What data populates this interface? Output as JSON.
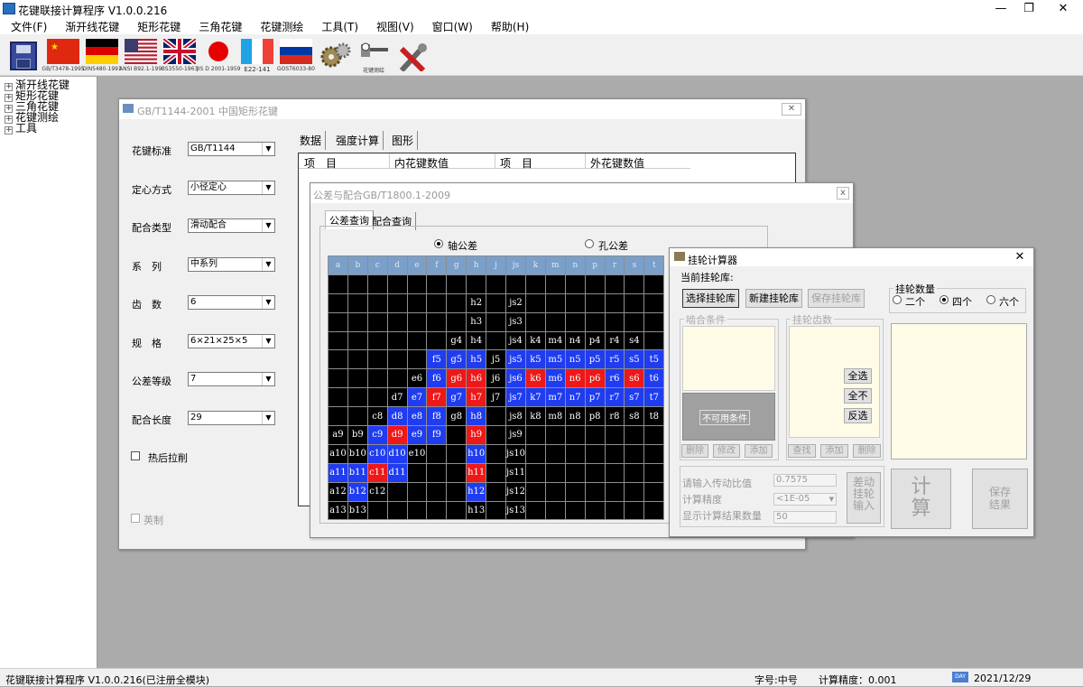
{
  "app": {
    "title": "花键联接计算程序 V1.0.0.216"
  },
  "menu": [
    "文件(F)",
    "渐开线花键",
    "矩形花键",
    "三角花键",
    "花键测绘",
    "工具(T)",
    "视图(V)",
    "窗口(W)",
    "帮助(H)"
  ],
  "toolbar": [
    {
      "icon": "save-icon",
      "caption": ""
    },
    {
      "icon": "china-flag-icon",
      "caption": "GB/T3478-1995"
    },
    {
      "icon": "germany-flag-icon",
      "caption": "DIN5480-1991"
    },
    {
      "icon": "usa-flag-icon",
      "caption": "ANSI B92.1-1996"
    },
    {
      "icon": "uk-flag-icon",
      "caption": "BS3550-1963"
    },
    {
      "icon": "japan-flag-icon",
      "caption": "JIS D 2001-1959"
    },
    {
      "icon": "france-flag-icon",
      "caption": "E22-141"
    },
    {
      "icon": "russia-flag-icon",
      "caption": "GOST6033-80"
    },
    {
      "icon": "gears-icon",
      "caption": ""
    },
    {
      "icon": "measure-icon",
      "caption": "花键测绘"
    },
    {
      "icon": "tools-icon",
      "caption": ""
    }
  ],
  "tree": [
    "渐开线花键",
    "矩形花键",
    "三角花键",
    "花键测绘",
    "工具"
  ],
  "status": {
    "left": "花键联接计算程序  V1.0.0.216(已注册全模块)",
    "font": "字号:中号",
    "precision": "计算精度：0.001",
    "date": "2021/12/29",
    "day_icon": "DAY"
  },
  "rect_window": {
    "title": "GB/T1144-2001 中国矩形花键",
    "close": "✕",
    "fields": [
      {
        "label": "花键标准",
        "value": "GB/T1144"
      },
      {
        "label": "定心方式",
        "value": "小径定心"
      },
      {
        "label": "配合类型",
        "value": "滑动配合"
      },
      {
        "label": "系　列",
        "value": "中系列"
      },
      {
        "label": "齿　数",
        "value": "6"
      },
      {
        "label": "规　格",
        "value": "6×21×25×5"
      },
      {
        "label": "公差等级",
        "value": "7"
      },
      {
        "label": "配合长度",
        "value": "29"
      }
    ],
    "hot_broach": "热后拉削",
    "imperial": "英制",
    "tabs": [
      "数据",
      "强度计算",
      "图形"
    ],
    "table_headers": [
      "项　目",
      "内花键数值",
      "项　目",
      "外花键数值"
    ]
  },
  "tol_window": {
    "title": "公差与配合GB/T1800.1-2009",
    "close": "x",
    "tabs": [
      "公差查询",
      "配合查询"
    ],
    "radio_shaft": "轴公差",
    "radio_hole": "孔公差",
    "columns": [
      "a",
      "b",
      "c",
      "d",
      "e",
      "f",
      "g",
      "h",
      "j",
      "js",
      "k",
      "m",
      "n",
      "p",
      "r",
      "s",
      "t"
    ],
    "rows": [
      [
        "",
        "",
        "",
        "",
        "",
        "",
        "",
        "",
        "",
        "",
        "",
        "",
        "",
        "",
        "",
        "",
        ""
      ],
      [
        "",
        "",
        "",
        "",
        "",
        "",
        "",
        "h2",
        "",
        "js2",
        "",
        "",
        "",
        "",
        "",
        "",
        ""
      ],
      [
        "",
        "",
        "",
        "",
        "",
        "",
        "",
        "h3",
        "",
        "js3",
        "",
        "",
        "",
        "",
        "",
        "",
        ""
      ],
      [
        "",
        "",
        "",
        "",
        "",
        "",
        "g4",
        "h4",
        "",
        "js4",
        "k4",
        "m4",
        "n4",
        "p4",
        "r4",
        "s4",
        ""
      ],
      [
        "",
        "",
        "",
        "",
        "",
        "f5",
        "g5",
        "h5",
        "j5",
        "js5",
        "k5",
        "m5",
        "n5",
        "p5",
        "r5",
        "s5",
        "t5"
      ],
      [
        "",
        "",
        "",
        "",
        "e6",
        "f6",
        "g6",
        "h6",
        "j6",
        "js6",
        "k6",
        "m6",
        "n6",
        "p6",
        "r6",
        "s6",
        "t6"
      ],
      [
        "",
        "",
        "",
        "d7",
        "e7",
        "f7",
        "g7",
        "h7",
        "j7",
        "js7",
        "k7",
        "m7",
        "n7",
        "p7",
        "r7",
        "s7",
        "t7"
      ],
      [
        "",
        "",
        "c8",
        "d8",
        "e8",
        "f8",
        "g8",
        "h8",
        "",
        "js8",
        "k8",
        "m8",
        "n8",
        "p8",
        "r8",
        "s8",
        "t8"
      ],
      [
        "a9",
        "b9",
        "c9",
        "d9",
        "e9",
        "f9",
        "",
        "h9",
        "",
        "js9",
        "",
        "",
        "",
        "",
        "",
        "",
        ""
      ],
      [
        "a10",
        "b10",
        "c10",
        "d10",
        "e10",
        "",
        "",
        "h10",
        "",
        "js10",
        "",
        "",
        "",
        "",
        "",
        "",
        ""
      ],
      [
        "a11",
        "b11",
        "c11",
        "d11",
        "",
        "",
        "",
        "h11",
        "",
        "js11",
        "",
        "",
        "",
        "",
        "",
        "",
        ""
      ],
      [
        "a12",
        "b12",
        "c12",
        "",
        "",
        "",
        "",
        "h12",
        "",
        "js12",
        "",
        "",
        "",
        "",
        "",
        "",
        ""
      ],
      [
        "a13",
        "b13",
        "",
        "",
        "",
        "",
        "",
        "h13",
        "",
        "js13",
        "",
        "",
        "",
        "",
        "",
        "",
        ""
      ]
    ],
    "colors": [
      "",
      "",
      "",
      "",
      "",
      "",
      "",
      "",
      "",
      "",
      "",
      "",
      "",
      "",
      "",
      "",
      "",
      "",
      "",
      "",
      "",
      "",
      "",
      "",
      "",
      "",
      "",
      "",
      "",
      "",
      "",
      "",
      "",
      "",
      "",
      "",
      "",
      "",
      "",
      "",
      "",
      "",
      "",
      "",
      "",
      "",
      "",
      "",
      "",
      "",
      "",
      "",
      "",
      "",
      "",
      "",
      "",
      "",
      "",
      "",
      "",
      "",
      "",
      "",
      "",
      "",
      "",
      "",
      "",
      "",
      "",
      "",
      "",
      "b",
      "b",
      "b",
      "",
      "b",
      "b",
      "b",
      "b",
      "b",
      "b",
      "b",
      "b",
      "",
      "",
      "",
      "",
      "",
      "b",
      "r",
      "r",
      "",
      "b",
      "r",
      "b",
      "r",
      "r",
      "b",
      "r",
      "b",
      "",
      "",
      "",
      "",
      "b",
      "r",
      "b",
      "r",
      "",
      "b",
      "b",
      "b",
      "b",
      "b",
      "b",
      "b",
      "b",
      "",
      "",
      "",
      "b",
      "b",
      "b",
      "",
      "b",
      "",
      "",
      "",
      "",
      "",
      "",
      "",
      "",
      "",
      "",
      "",
      "b",
      "r",
      "b",
      "b",
      "",
      "r",
      "",
      "",
      "",
      "",
      "",
      "",
      "",
      "",
      "",
      "",
      "",
      "b",
      "b",
      "",
      "",
      "",
      "b",
      "",
      "",
      "",
      "",
      "",
      "",
      "",
      "",
      "",
      "b",
      "b",
      "r",
      "b",
      "",
      "",
      "",
      "r",
      "",
      "",
      "",
      "",
      "",
      "",
      "",
      "",
      "",
      "",
      "b",
      "",
      "",
      "",
      "",
      "",
      "b",
      "",
      "",
      "",
      "",
      "",
      "",
      "",
      "",
      "",
      "",
      "",
      "",
      "",
      "",
      "",
      "",
      "",
      "",
      "",
      "",
      "",
      "",
      "",
      "",
      "",
      ""
    ]
  },
  "gear_window": {
    "title": "挂轮计算器",
    "current_lib": "当前挂轮库:",
    "btn_select": "选择挂轮库",
    "btn_new": "新建挂轮库",
    "btn_save_lib": "保存挂轮库",
    "count_group": "挂轮数量",
    "opt2": "二个",
    "opt4": "四个",
    "opt6": "六个",
    "mesh_group": "啮合条件",
    "unused": "不可用条件",
    "teeth_group": "挂轮齿数",
    "btn_all": "全选",
    "btn_none": "全不",
    "btn_inv": "反选",
    "btn_del1": "删除",
    "btn_edit": "修改",
    "btn_add1": "添加",
    "btn_find": "查找",
    "btn_add2": "添加",
    "btn_del2": "删除",
    "ratio_label": "请输入传动比值",
    "ratio_value": "0.7575",
    "prec_label": "计算精度",
    "prec_value": "<1E-05",
    "count_label": "显示计算结果数量",
    "count_value": "50",
    "btn_diff": "差动\n挂轮\n输入",
    "btn_calc": "计\n算",
    "btn_save": "保存\n结果"
  },
  "accent": {
    "blue": "#1f3cf0",
    "red": "#ee1818",
    "header": "#7a9fc9"
  }
}
